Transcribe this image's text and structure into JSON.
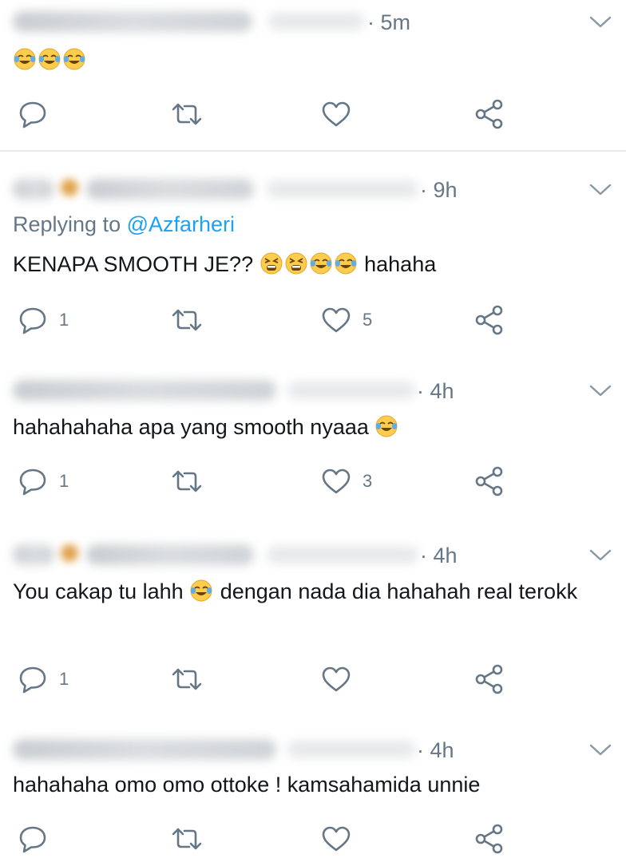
{
  "tweets": [
    {
      "time": "· 5m",
      "reply_to_prefix": "",
      "reply_to_handle": "",
      "text_before": "",
      "emojis_before": [
        "face-with-tears-of-joy-icon",
        "face-with-tears-of-joy-icon",
        "face-with-tears-of-joy-icon"
      ],
      "text_after": "",
      "reply_count": "",
      "like_count": ""
    },
    {
      "time": "· 9h",
      "reply_to_prefix": "Replying to ",
      "reply_to_handle": "@Azfarheri",
      "text_before": "KENAPA SMOOTH JE??",
      "emojis": [
        "tired-face-icon",
        "tired-face-icon",
        "face-with-tears-of-joy-icon",
        "face-with-tears-of-joy-icon"
      ],
      "text_after": "hahaha",
      "reply_count": "1",
      "like_count": "5"
    },
    {
      "time": "· 4h",
      "text_before": "hahahahaha apa yang smooth nyaaa",
      "emojis": [
        "face-with-tears-of-joy-icon"
      ],
      "text_after": "",
      "reply_count": "1",
      "like_count": "3"
    },
    {
      "time": "· 4h",
      "text_before": "You cakap tu lahh",
      "emojis": [
        "face-with-tears-of-joy-icon"
      ],
      "text_after": "dengan nada dia hahahah real terokk",
      "reply_count": "1",
      "like_count": ""
    },
    {
      "time": "· 4h",
      "text_before": "hahahaha omo omo ottoke ! kamsahamida unnie",
      "text_after": "",
      "reply_count": "",
      "like_count": ""
    }
  ],
  "icons": {
    "reply": "reply-icon",
    "retweet": "retweet-icon",
    "like": "heart-icon",
    "share": "share-icon",
    "menu": "chevron-down-icon"
  },
  "colors": {
    "icon": "#657786",
    "link": "#1da1f2",
    "text": "#14171a",
    "divider": "#e6ecf0"
  }
}
